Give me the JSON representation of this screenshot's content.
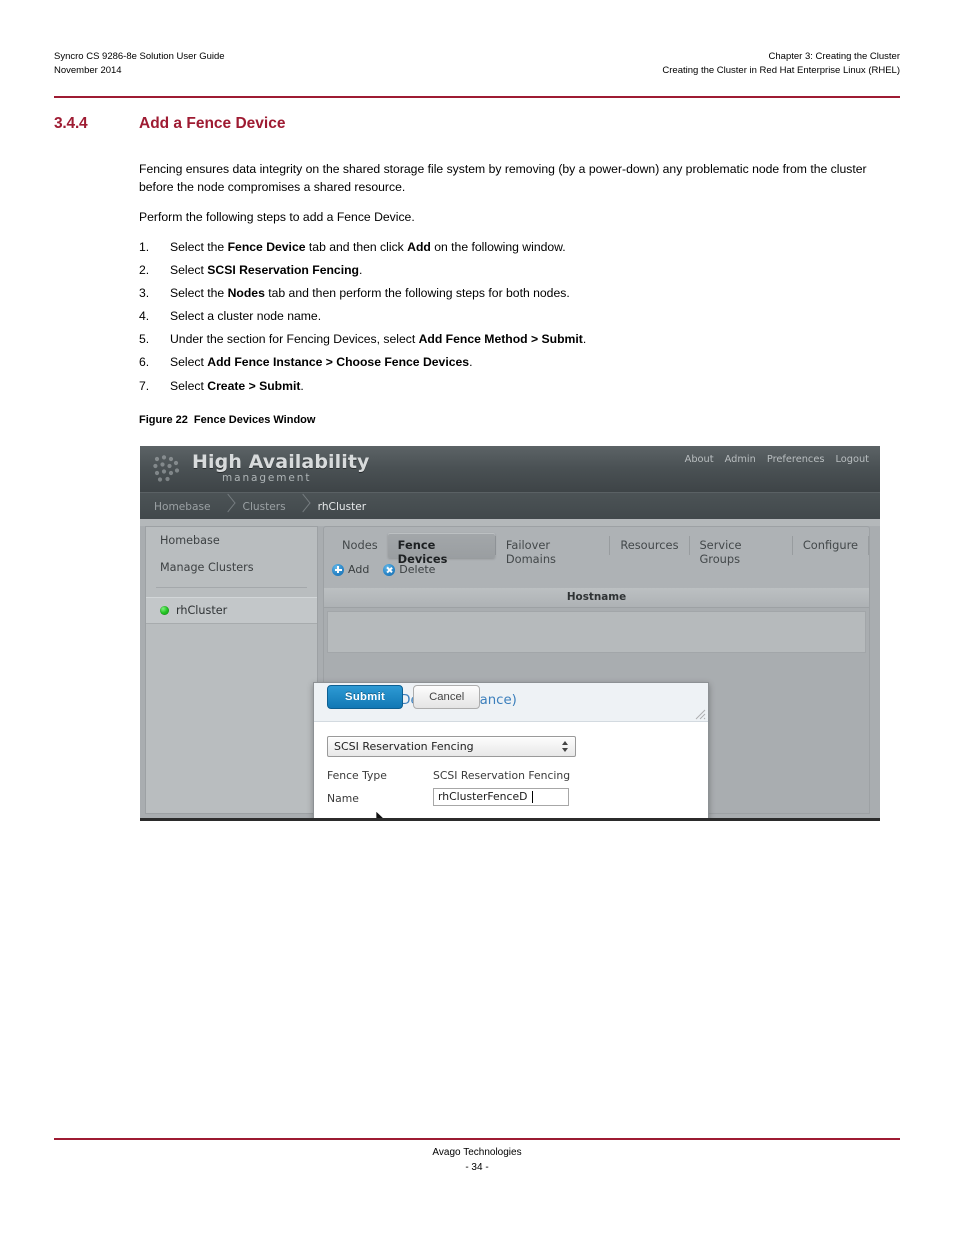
{
  "page_header": {
    "left_line1": "Syncro CS 9286-8e Solution User Guide",
    "left_line2": "November 2014",
    "right_line1": "Chapter 3: Creating the Cluster",
    "right_line2": "Creating the Cluster in Red Hat Enterprise Linux (RHEL)"
  },
  "section": {
    "number": "3.4.4",
    "title": "Add a Fence Device",
    "accent_color": "#9e1b32"
  },
  "body": {
    "paragraph_1": "Fencing ensures data integrity on the shared storage file system by removing (by a power-down) any problematic node from the cluster before the node compromises a shared resource.",
    "paragraph_2": "Perform the following steps to add a Fence Device."
  },
  "steps": [
    {
      "num": "1.",
      "parts": [
        {
          "t": "Select the ",
          "b": false
        },
        {
          "t": "Fence Device",
          "b": true
        },
        {
          "t": " tab and then click ",
          "b": false
        },
        {
          "t": "Add",
          "b": true
        },
        {
          "t": " on the following window.",
          "b": false
        }
      ]
    },
    {
      "num": "2.",
      "parts": [
        {
          "t": "Select ",
          "b": false
        },
        {
          "t": "SCSI Reservation Fencing",
          "b": true
        },
        {
          "t": ".",
          "b": false
        }
      ]
    },
    {
      "num": "3.",
      "parts": [
        {
          "t": "Select the ",
          "b": false
        },
        {
          "t": "Nodes",
          "b": true
        },
        {
          "t": " tab and then perform the following steps for both nodes.",
          "b": false
        }
      ]
    },
    {
      "num": "4.",
      "parts": [
        {
          "t": "Select a cluster node name.",
          "b": false
        }
      ]
    },
    {
      "num": "5.",
      "parts": [
        {
          "t": "Under the section for Fencing Devices, select ",
          "b": false
        },
        {
          "t": "Add Fence Method > Submit",
          "b": true
        },
        {
          "t": ".",
          "b": false
        }
      ]
    },
    {
      "num": "6.",
      "parts": [
        {
          "t": "Select ",
          "b": false
        },
        {
          "t": "Add Fence Instance > Choose Fence Devices",
          "b": true
        },
        {
          "t": ".",
          "b": false
        }
      ]
    },
    {
      "num": "7.",
      "parts": [
        {
          "t": "Select ",
          "b": false
        },
        {
          "t": "Create > Submit",
          "b": true
        },
        {
          "t": ".",
          "b": false
        }
      ]
    }
  ],
  "figure": {
    "label": "Figure 22",
    "title": "Fence Devices Window"
  },
  "app": {
    "brand_title": "High Availability",
    "brand_subtitle": "management",
    "logo_icon": "dot-cluster-logo-icon",
    "top_nav": [
      "About",
      "Admin",
      "Preferences",
      "Logout"
    ],
    "breadcrumbs": [
      {
        "label": "Homebase",
        "active": false
      },
      {
        "label": "Clusters",
        "active": false
      },
      {
        "label": "rhCluster",
        "active": true
      }
    ],
    "sidebar": {
      "links": [
        "Homebase",
        "Manage Clusters"
      ],
      "cluster_item": {
        "label": "rhCluster",
        "status_color": "#23c423",
        "status_icon": "status-dot-icon"
      }
    },
    "tabs": [
      {
        "label": "Nodes",
        "active": false
      },
      {
        "label": "Fence Devices",
        "active": true
      },
      {
        "label": "Failover Domains",
        "active": false
      },
      {
        "label": "Resources",
        "active": false
      },
      {
        "label": "Service Groups",
        "active": false
      },
      {
        "label": "Configure",
        "active": false
      }
    ],
    "toolbar": [
      {
        "label": "Add",
        "icon": "plus-circle-icon"
      },
      {
        "label": "Delete",
        "icon": "x-circle-icon"
      }
    ],
    "table": {
      "columns": [
        "Hostname"
      ],
      "rows": []
    },
    "dialog": {
      "title": "Add Fence Device (Instance)",
      "device_select": {
        "value": "SCSI Reservation Fencing",
        "icon": "updown-arrows-icon"
      },
      "fields": [
        {
          "label": "Fence Type",
          "value": "SCSI Reservation Fencing",
          "editable": false
        },
        {
          "label": "Name",
          "value": "rhClusterFenceD",
          "editable": true
        }
      ],
      "submit_label": "Submit",
      "cancel_label": "Cancel",
      "resize_icon": "resize-grip-icon",
      "primary_color": "#1178b5"
    },
    "cursor_icon": "mouse-pointer-icon"
  },
  "footer": {
    "company": "Avago Technologies",
    "page_number": "- 34 -"
  }
}
